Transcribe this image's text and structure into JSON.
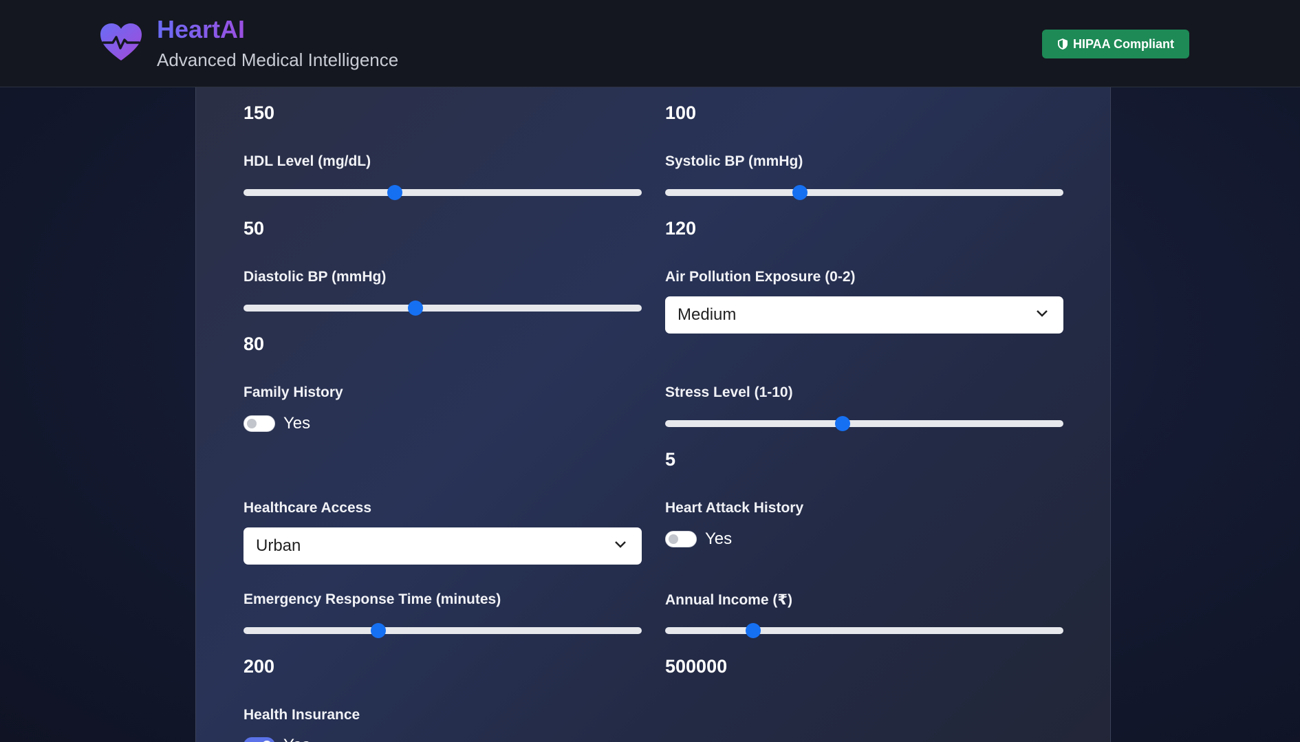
{
  "header": {
    "brand": "HeartAI",
    "subtitle": "Advanced Medical Intelligence",
    "badge": "HIPAA Compliant"
  },
  "form": {
    "top_values": {
      "left": "150",
      "right": "100"
    },
    "hdl": {
      "label": "HDL Level (mg/dL)",
      "value": "50",
      "fraction": 0.38
    },
    "systolic": {
      "label": "Systolic BP (mmHg)",
      "value": "120",
      "fraction": 0.338
    },
    "diastolic": {
      "label": "Diastolic BP (mmHg)",
      "value": "80",
      "fraction": 0.432
    },
    "air_pollution": {
      "label": "Air Pollution Exposure (0-2)",
      "selected": "Medium"
    },
    "family_history": {
      "label": "Family History",
      "toggle_text": "Yes",
      "on": false
    },
    "stress": {
      "label": "Stress Level (1-10)",
      "value": "5",
      "fraction": 0.446
    },
    "healthcare_access": {
      "label": "Healthcare Access",
      "selected": "Urban"
    },
    "heart_attack_history": {
      "label": "Heart Attack History",
      "toggle_text": "Yes",
      "on": false
    },
    "emergency_response": {
      "label": "Emergency Response Time (minutes)",
      "value": "200",
      "fraction": 0.339
    },
    "annual_income": {
      "label": "Annual Income (₹)",
      "value": "500000",
      "fraction": 0.221
    },
    "health_insurance": {
      "label": "Health Insurance",
      "toggle_text": "Yes",
      "on": true
    }
  },
  "colors": {
    "accent": "#1670f2",
    "badge": "#1e8a56",
    "brand_gradient_start": "#6a6cf5",
    "brand_gradient_end": "#9b4fe0"
  }
}
